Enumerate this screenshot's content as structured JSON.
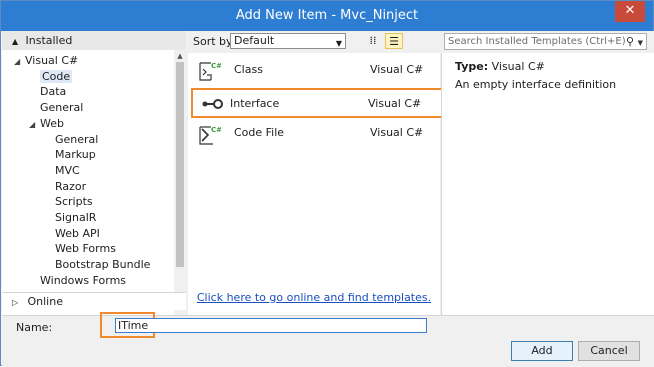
{
  "window": {
    "title": "Add New Item - Mvc_Ninject",
    "close_glyph": "✕"
  },
  "left": {
    "header": "Installed",
    "tree": [
      {
        "label": "Visual C#",
        "arrow": "◢",
        "indent": 0
      },
      {
        "label": "Code",
        "arrow": "",
        "indent": 1,
        "selected": true
      },
      {
        "label": "Data",
        "arrow": "",
        "indent": 1
      },
      {
        "label": "General",
        "arrow": "",
        "indent": 1
      },
      {
        "label": "Web",
        "arrow": "◢",
        "indent": 1
      },
      {
        "label": "General",
        "arrow": "",
        "indent": 2
      },
      {
        "label": "Markup",
        "arrow": "",
        "indent": 2
      },
      {
        "label": "MVC",
        "arrow": "",
        "indent": 2
      },
      {
        "label": "Razor",
        "arrow": "",
        "indent": 2
      },
      {
        "label": "Scripts",
        "arrow": "",
        "indent": 2
      },
      {
        "label": "SignalR",
        "arrow": "",
        "indent": 2
      },
      {
        "label": "Web API",
        "arrow": "",
        "indent": 2
      },
      {
        "label": "Web Forms",
        "arrow": "",
        "indent": 2
      },
      {
        "label": "Bootstrap Bundle",
        "arrow": "",
        "indent": 2
      },
      {
        "label": "Windows Forms",
        "arrow": "",
        "indent": 1
      }
    ],
    "online": "Online"
  },
  "sort": {
    "label": "Sort by:",
    "value": "Default"
  },
  "items": [
    {
      "name": "Class",
      "lang": "Visual C#",
      "icon": "class-icon"
    },
    {
      "name": "Interface",
      "lang": "Visual C#",
      "icon": "interface-icon",
      "highlight": true
    },
    {
      "name": "Code File",
      "lang": "Visual C#",
      "icon": "code-file-icon"
    }
  ],
  "online_link": "Click here to go online and find templates.",
  "search": {
    "placeholder": "Search Installed Templates (Ctrl+E)"
  },
  "details": {
    "type_label": "Type:",
    "type_value": "Visual C#",
    "description": "An empty interface definition"
  },
  "bottom": {
    "name_label": "Name:",
    "name_value": "ITime",
    "add_label": "Add",
    "cancel_label": "Cancel"
  },
  "colors": {
    "titlebar": "#2d7dd2",
    "highlight": "#f08a2c",
    "link": "#1a4fbf"
  }
}
